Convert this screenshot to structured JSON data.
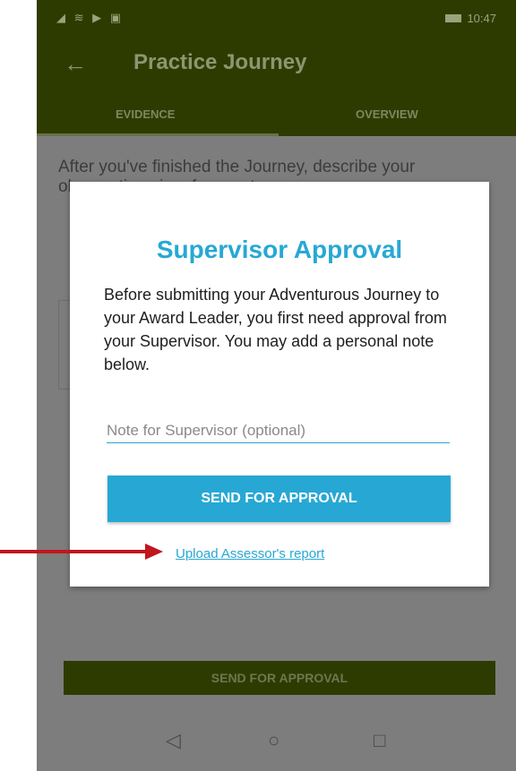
{
  "status": {
    "icons": "◢ ≋ ▶ ▣",
    "time": "10:47"
  },
  "appbar": {
    "back_glyph": "←",
    "title": "Practice Journey"
  },
  "tabs": [
    {
      "label": "EVIDENCE"
    },
    {
      "label": "OVERVIEW"
    }
  ],
  "background": {
    "text": "After you've finished the Journey, describe your observations in a few sentences.",
    "button_label": "SEND FOR APPROVAL"
  },
  "dialog": {
    "title": "Supervisor Approval",
    "message": "Before submitting your Adventurous Journey to your Award Leader, you first need approval from your Supervisor. You may add a personal note below.",
    "note_placeholder": "Note for Supervisor (optional)",
    "button_label": "SEND FOR APPROVAL",
    "link_label": "Upload Assessor's report"
  },
  "navbar": {
    "back": "◁",
    "home": "○",
    "recent": "□"
  },
  "colors": {
    "accent": "#27a8d4",
    "appbar": "#2e3b00",
    "arrow": "#c0161d",
    "scrim": "#7d7d7d"
  }
}
